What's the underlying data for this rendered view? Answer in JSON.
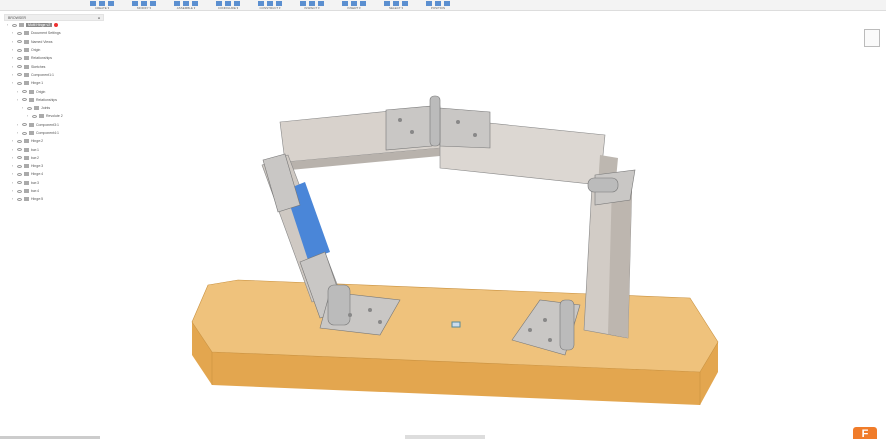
{
  "toolbar": {
    "groups": [
      "CREATE ▾",
      "MODIFY ▾",
      "ASSEMBLE ▾",
      "CONFIGURE ▾",
      "CONSTRUCT ▾",
      "INSPECT ▾",
      "INSERT ▾",
      "SELECT ▾",
      "POSITION"
    ]
  },
  "browser": {
    "title": "BROWSER",
    "nodes": [
      {
        "label": "Multi Hinge v2",
        "level": 0,
        "root": true
      },
      {
        "label": "Document Settings",
        "level": 1
      },
      {
        "label": "Named Views",
        "level": 1
      },
      {
        "label": "Origin",
        "level": 1
      },
      {
        "label": "Relationships",
        "level": 1
      },
      {
        "label": "Sketches",
        "level": 1
      },
      {
        "label": "Component1:1",
        "level": 1
      },
      {
        "label": "Hinge:1",
        "level": 1
      },
      {
        "label": "Origin",
        "level": 2
      },
      {
        "label": "Relationships",
        "level": 2
      },
      {
        "label": "Joints",
        "level": 3
      },
      {
        "label": "Revolute 2",
        "level": 4
      },
      {
        "label": "Component3:1",
        "level": 2
      },
      {
        "label": "Component4:1",
        "level": 2
      },
      {
        "label": "Hinge:2",
        "level": 1
      },
      {
        "label": "bar:1",
        "level": 1
      },
      {
        "label": "bar:2",
        "level": 1
      },
      {
        "label": "Hinge:3",
        "level": 1
      },
      {
        "label": "Hinge:4",
        "level": 1
      },
      {
        "label": "bar:3",
        "level": 1
      },
      {
        "label": "bar:4",
        "level": 1
      },
      {
        "label": "Hinge:5",
        "level": 1
      }
    ]
  },
  "badge": "F",
  "colors": {
    "wood": "#e8b567",
    "bar": "#d9d4cf",
    "selected": "#4a86d8",
    "accent": "#f07c2a"
  }
}
